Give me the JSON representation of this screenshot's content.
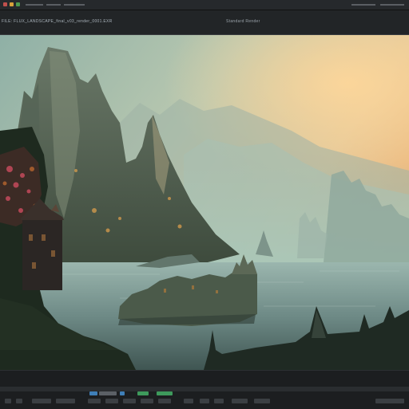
{
  "toolbar": {
    "icons": [
      "close-icon",
      "minimize-icon",
      "maximize-icon"
    ]
  },
  "infobar": {
    "left_text": "FILE: FLUX_LANDSCAPE_final_v03_render_0001.EXR",
    "center_text": "Standard Render"
  },
  "colors": {
    "chrome_dark": "#1b1d1f",
    "chrome_bar": "#26292c",
    "accent_blue": "#3f7fb8",
    "accent_green": "#3e9a5c"
  },
  "viewport": {
    "content": "fantasy landscape render"
  }
}
